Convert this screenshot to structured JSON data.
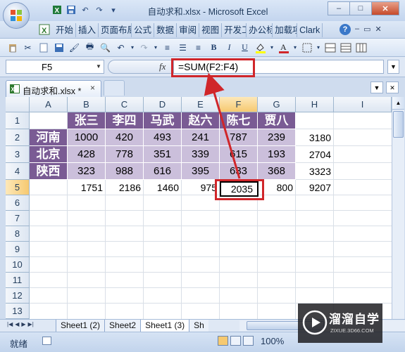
{
  "window": {
    "title": "自动求和.xlsx - Microsoft Excel",
    "controls": [
      "–",
      "□",
      "✕"
    ]
  },
  "ribbon": {
    "tabs": [
      "开始",
      "插入",
      "页面布局",
      "公式",
      "数据",
      "审阅",
      "视图",
      "开发工具",
      "办公标签",
      "加载项",
      "Clark"
    ],
    "help": "?"
  },
  "formula_bar": {
    "name_box": "F5",
    "fx": "fx",
    "formula": "=SUM(F2:F4)"
  },
  "workbook_tab": {
    "title": "自动求和.xlsx *",
    "close": "×"
  },
  "sheet": {
    "columns": [
      "A",
      "B",
      "C",
      "D",
      "E",
      "F",
      "G",
      "H",
      "I"
    ],
    "rows": [
      "1",
      "2",
      "3",
      "4",
      "5",
      "6",
      "7",
      "8",
      "9",
      "10",
      "11",
      "12",
      "13"
    ],
    "active_cell": "F5",
    "header_row": [
      "张三",
      "李四",
      "马武",
      "赵六",
      "陈七",
      "贾八"
    ],
    "provinces": [
      "河南",
      "北京",
      "陕西"
    ],
    "values": [
      [
        1000,
        420,
        493,
        241,
        787,
        239
      ],
      [
        428,
        778,
        351,
        339,
        615,
        193
      ],
      [
        323,
        988,
        616,
        395,
        633,
        368
      ]
    ],
    "row_totals": [
      3180,
      2704,
      3323
    ],
    "column_totals": [
      1751,
      2186,
      1460,
      975,
      2035,
      800
    ],
    "grand_total": 9207
  },
  "sheet_tabs": [
    "Sheet1 (2)",
    "Sheet2",
    "Sheet1 (3)",
    "Sh"
  ],
  "status": {
    "ready": "就绪",
    "zoom": "100%"
  },
  "watermark": {
    "title": "溜溜自学",
    "url": "ZIXUE.3D66.COM"
  },
  "colors": {
    "header_fill": "#7a5b94",
    "value_fill": "#cbbfdb",
    "highlight_red": "#d0262a"
  }
}
